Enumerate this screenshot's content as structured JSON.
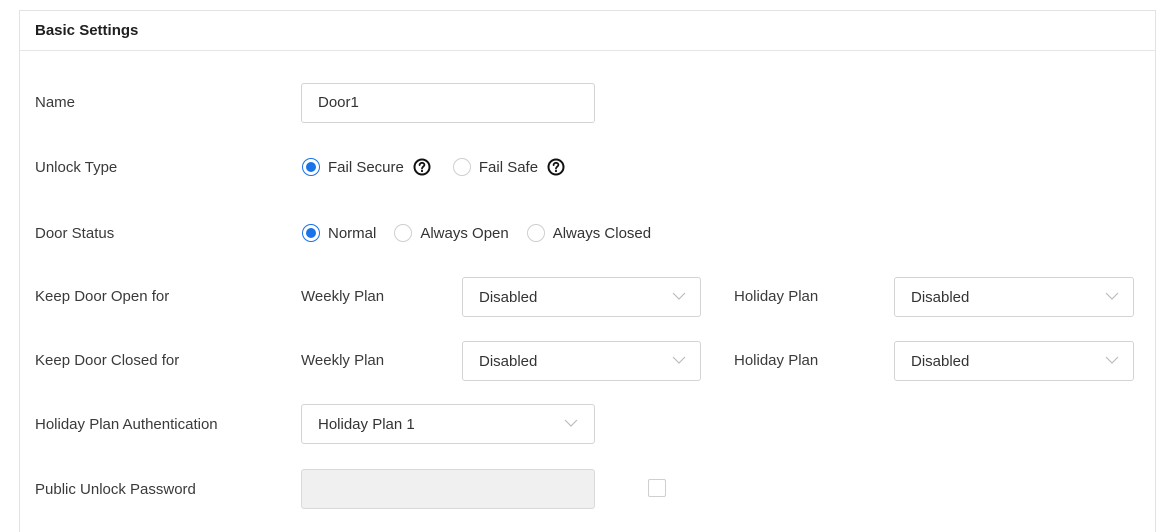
{
  "section": {
    "title": "Basic Settings"
  },
  "name": {
    "label": "Name",
    "value": "Door1"
  },
  "unlock_type": {
    "label": "Unlock Type",
    "options": [
      "Fail Secure",
      "Fail Safe"
    ],
    "selected": "Fail Secure"
  },
  "door_status": {
    "label": "Door Status",
    "options": [
      "Normal",
      "Always Open",
      "Always Closed"
    ],
    "selected": "Normal"
  },
  "keep_open": {
    "label": "Keep Door Open for",
    "weekly_label": "Weekly Plan",
    "weekly_value": "Disabled",
    "holiday_label": "Holiday Plan",
    "holiday_value": "Disabled"
  },
  "keep_closed": {
    "label": "Keep Door Closed for",
    "weekly_label": "Weekly Plan",
    "weekly_value": "Disabled",
    "holiday_label": "Holiday Plan",
    "holiday_value": "Disabled"
  },
  "holiday_auth": {
    "label": "Holiday Plan Authentication",
    "value": "Holiday Plan 1"
  },
  "public_password": {
    "label": "Public Unlock Password",
    "value": "",
    "enabled": false
  },
  "colors": {
    "accent": "#1a73e8",
    "border": "#d4d4d4",
    "disabled_bg": "#f0f0f0"
  },
  "icons": {
    "help": "question-circle-icon",
    "chevron": "chevron-down-icon"
  }
}
